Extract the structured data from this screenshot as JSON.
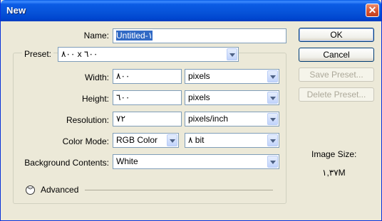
{
  "window": {
    "title": "New"
  },
  "form": {
    "name_label": "Name:",
    "name_value": "Untitled-١",
    "preset_label": "Preset:",
    "preset_value": "٨٠٠ x ٦٠٠",
    "width_label": "Width:",
    "width_value": "٨٠٠",
    "width_unit": "pixels",
    "height_label": "Height:",
    "height_value": "٦٠٠",
    "height_unit": "pixels",
    "resolution_label": "Resolution:",
    "resolution_value": "٧٢",
    "resolution_unit": "pixels/inch",
    "color_mode_label": "Color Mode:",
    "color_mode_value": "RGB Color",
    "bit_depth_value": "٨ bit",
    "background_label": "Background Contents:",
    "background_value": "White",
    "advanced_label": "Advanced"
  },
  "buttons": {
    "ok": "OK",
    "cancel": "Cancel",
    "save_preset": "Save Preset...",
    "delete_preset": "Delete Preset..."
  },
  "info": {
    "image_size_label": "Image Size:",
    "image_size_value": "١,٣٧M"
  },
  "icons": {
    "close": "close-icon",
    "dropdown": "chevron-down-icon",
    "advanced": "double-chevron-down-icon"
  },
  "colors": {
    "titlebar": "#0652d8",
    "selection": "#316ac5",
    "face": "#ece9d8"
  }
}
